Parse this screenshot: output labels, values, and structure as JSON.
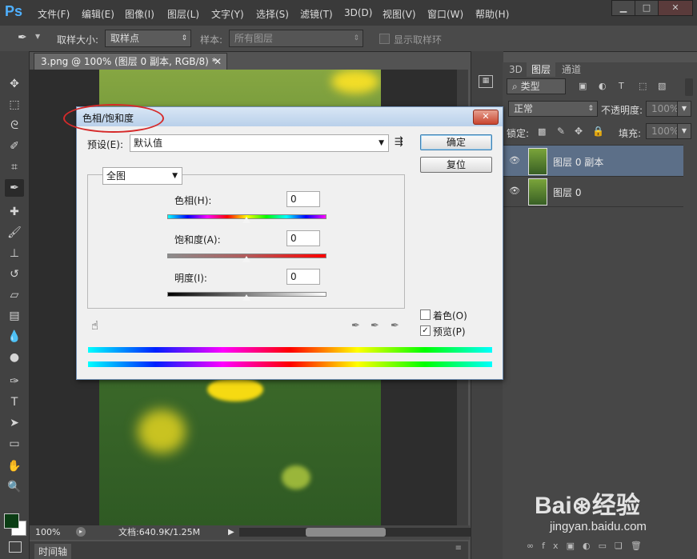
{
  "app": {
    "logo": "Ps"
  },
  "menu": [
    "文件(F)",
    "编辑(E)",
    "图像(I)",
    "图层(L)",
    "文字(Y)",
    "选择(S)",
    "滤镜(T)",
    "3D(D)",
    "视图(V)",
    "窗口(W)",
    "帮助(H)"
  ],
  "options_bar": {
    "sample_size_label": "取样大小:",
    "sample_size_value": "取样点",
    "sample_label": "样本:",
    "sample_value": "所有图层",
    "show_ring_label": "显示取样环"
  },
  "document": {
    "tab_title": "3.png @ 100% (图层 0 副本, RGB/8) *",
    "zoom": "100%",
    "doc_info": "文档:640.9K/1.25M",
    "timeline_label": "时间轴"
  },
  "dialog": {
    "title": "色相/饱和度",
    "preset_label": "预设(E):",
    "preset_value": "默认值",
    "ok_label": "确定",
    "reset_label": "复位",
    "channel_value": "全图",
    "hue_label": "色相(H):",
    "hue_value": "0",
    "saturation_label": "饱和度(A):",
    "saturation_value": "0",
    "lightness_label": "明度(I):",
    "lightness_value": "0",
    "colorize_label": "着色(O)",
    "colorize_checked": false,
    "preview_label": "预览(P)",
    "preview_checked": true
  },
  "layers_panel": {
    "tabs": [
      "3D",
      "图层",
      "通道"
    ],
    "active_tab": "图层",
    "filter_label": "类型",
    "blend_mode": "正常",
    "opacity_label": "不透明度:",
    "opacity_value": "100%",
    "lock_label": "锁定:",
    "fill_label": "填充:",
    "fill_value": "100%",
    "layers": [
      {
        "name": "图层 0 副本",
        "visible": true,
        "selected": true
      },
      {
        "name": "图层 0",
        "visible": true,
        "selected": false
      }
    ]
  },
  "colors": {
    "accent_selection": "#5c6f88",
    "foreground": "#0b3d14",
    "background": "#ffffff",
    "annotation_circle": "#d62a2a"
  }
}
